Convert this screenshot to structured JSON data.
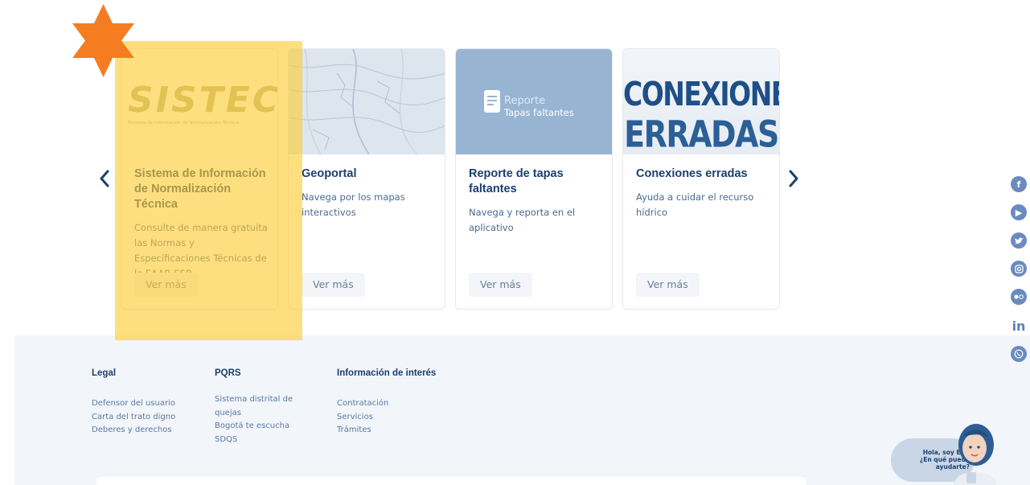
{
  "carousel": {
    "cards": [
      {
        "title": "Sistema de Información de Normalización Técnica",
        "description": "Consulte de manera gratuita las Normas y Especificaciones Técnicas de la EAAB-ESP.",
        "button": "Ver más",
        "image": {
          "logo": "SISTEC",
          "subtitle": "Sistema de Información de Normalización Técnica"
        }
      },
      {
        "title": "Geoportal",
        "description": "Navega por los mapas interactivos",
        "button": "Ver más"
      },
      {
        "title": "Reporte de tapas faltantes",
        "description": "Navega y reporta en el aplicativo",
        "button": "Ver más",
        "image": {
          "line1": "Reporte",
          "line2": "Tapas faltantes"
        }
      },
      {
        "title": "Conexiones erradas",
        "description": "Ayuda a cuidar el recurso hídrico",
        "button": "Ver más",
        "image": {
          "line1": "CONEXIONES",
          "line2": "ERRADAS"
        }
      }
    ],
    "prev_icon": "chevron-left-icon",
    "next_icon": "chevron-right-icon"
  },
  "footer": {
    "columns": [
      {
        "title": "Legal",
        "links": [
          "Defensor del usuario",
          "Carta del trato digno",
          "Deberes y derechos"
        ]
      },
      {
        "title": "PQRS",
        "links": [
          "Sistema distrital de quejas",
          "Bogotá te escucha",
          "SDQS"
        ]
      },
      {
        "title": "Información de interés",
        "links": [
          "Contratación",
          "Servicios",
          "Trámites"
        ]
      }
    ]
  },
  "social": [
    "facebook-icon",
    "youtube-icon",
    "twitter-icon",
    "instagram-icon",
    "flickr-icon",
    "linkedin-icon",
    "whatsapp-icon"
  ],
  "chatbot": {
    "line1": "Hola, soy EBA",
    "line2": "¿En qué puedo",
    "line3": "ayudarte?"
  },
  "colors": {
    "highlight": "#fdcb30",
    "star": "#f57c20",
    "brand": "#1d3f6e",
    "footer_bg": "#f2f5f9"
  }
}
